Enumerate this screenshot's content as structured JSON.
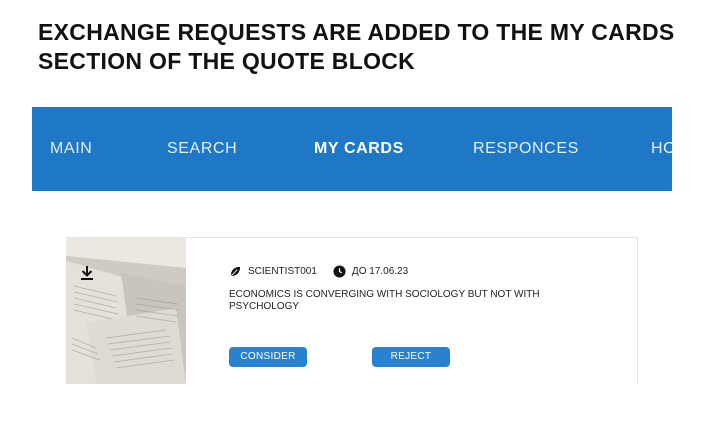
{
  "heading": "EXCHANGE REQUESTS ARE ADDED TO THE MY CARDS SECTION OF THE QUOTE BLOCK",
  "nav": {
    "items": [
      {
        "label": "MAIN",
        "active": false
      },
      {
        "label": "SEARCH",
        "active": false
      },
      {
        "label": "MY CARDS",
        "active": true
      },
      {
        "label": "RESPONCES",
        "active": false
      },
      {
        "label": "HOME",
        "active": false
      }
    ],
    "background": "#1e78c6"
  },
  "card": {
    "author": "SCIENTIST001",
    "deadline": "ДО 17.06.23",
    "quote": "ECONOMICS IS CONVERGING WITH SOCIOLOGY BUT NOT WITH PSYCHOLOGY",
    "consider_label": "CONSIDER",
    "reject_label": "REJECT",
    "image": "open-book-pages-photo",
    "icons": {
      "download": "download-icon",
      "author": "leaf-icon",
      "deadline": "clock-icon"
    },
    "button_color": "#2a82cf"
  }
}
